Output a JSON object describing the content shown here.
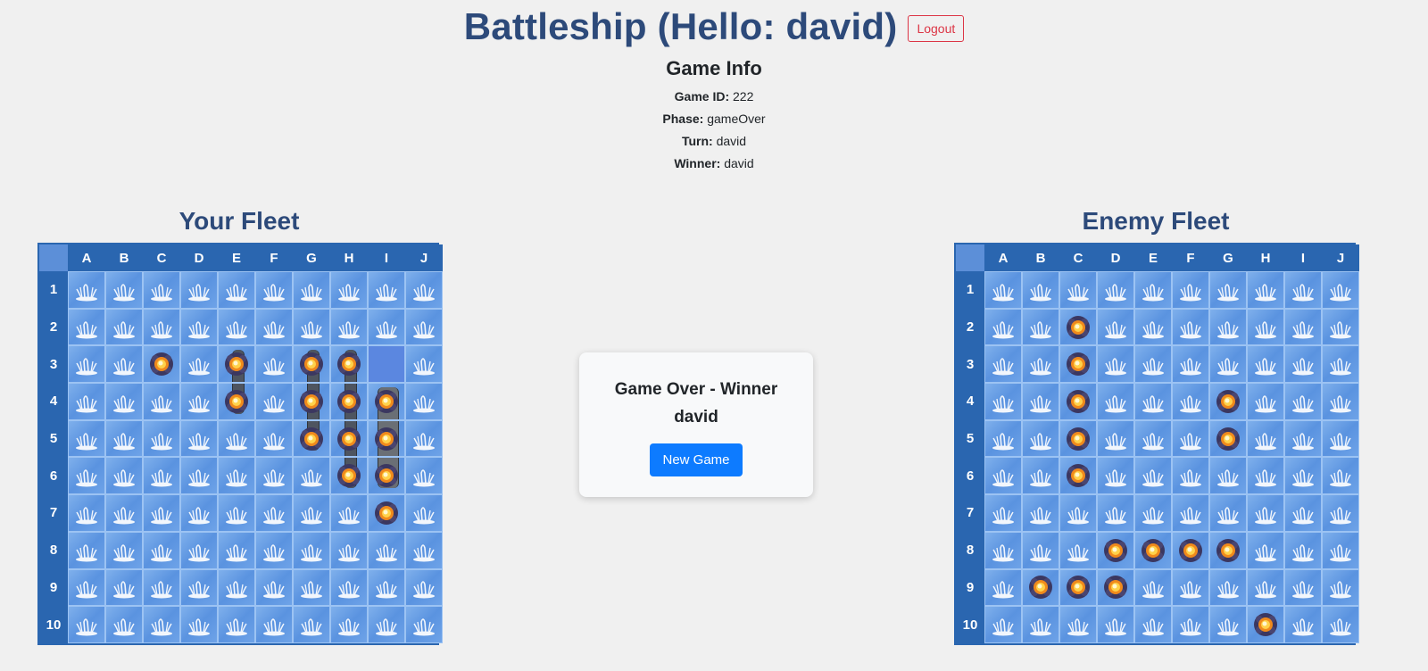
{
  "header": {
    "title": "Battleship (Hello: david)",
    "logout_label": "Logout"
  },
  "game_info": {
    "heading": "Game Info",
    "game_id_label": "Game ID:",
    "game_id": "222",
    "phase_label": "Phase:",
    "phase": "gameOver",
    "turn_label": "Turn:",
    "turn": "david",
    "winner_label": "Winner:",
    "winner": "david"
  },
  "columns": [
    "A",
    "B",
    "C",
    "D",
    "E",
    "F",
    "G",
    "H",
    "I",
    "J"
  ],
  "rows": [
    "1",
    "2",
    "3",
    "4",
    "5",
    "6",
    "7",
    "8",
    "9",
    "10"
  ],
  "your_fleet": {
    "title": "Your Fleet",
    "hits": [
      "C3",
      "E3",
      "E4",
      "G3",
      "G4",
      "G5",
      "H3",
      "H4",
      "H5",
      "H6",
      "I4",
      "I5",
      "I6",
      "I7"
    ],
    "empty": [
      "I3"
    ],
    "ships": [
      {
        "col": "E",
        "rows": [
          "3",
          "4"
        ]
      },
      {
        "col": "G",
        "rows": [
          "3",
          "4",
          "5"
        ]
      },
      {
        "col": "H",
        "rows": [
          "3",
          "4",
          "5",
          "6"
        ]
      },
      {
        "col": "I",
        "rows": [
          "4",
          "5",
          "6"
        ]
      }
    ]
  },
  "enemy_fleet": {
    "title": "Enemy Fleet",
    "hits": [
      "C2",
      "C3",
      "C4",
      "C5",
      "C6",
      "G4",
      "G5",
      "D8",
      "E8",
      "F8",
      "G8",
      "B9",
      "C9",
      "D9",
      "H10"
    ],
    "empty": []
  },
  "game_over": {
    "message": "Game Over - Winner david",
    "new_game_label": "New Game"
  },
  "colors": {
    "title": "#2d4a7a",
    "board_border": "#2a66b0",
    "primary_button": "#0d7bff",
    "logout": "#dc3545"
  },
  "icons": {
    "miss": "water-splash-icon",
    "hit": "explosion-icon"
  }
}
